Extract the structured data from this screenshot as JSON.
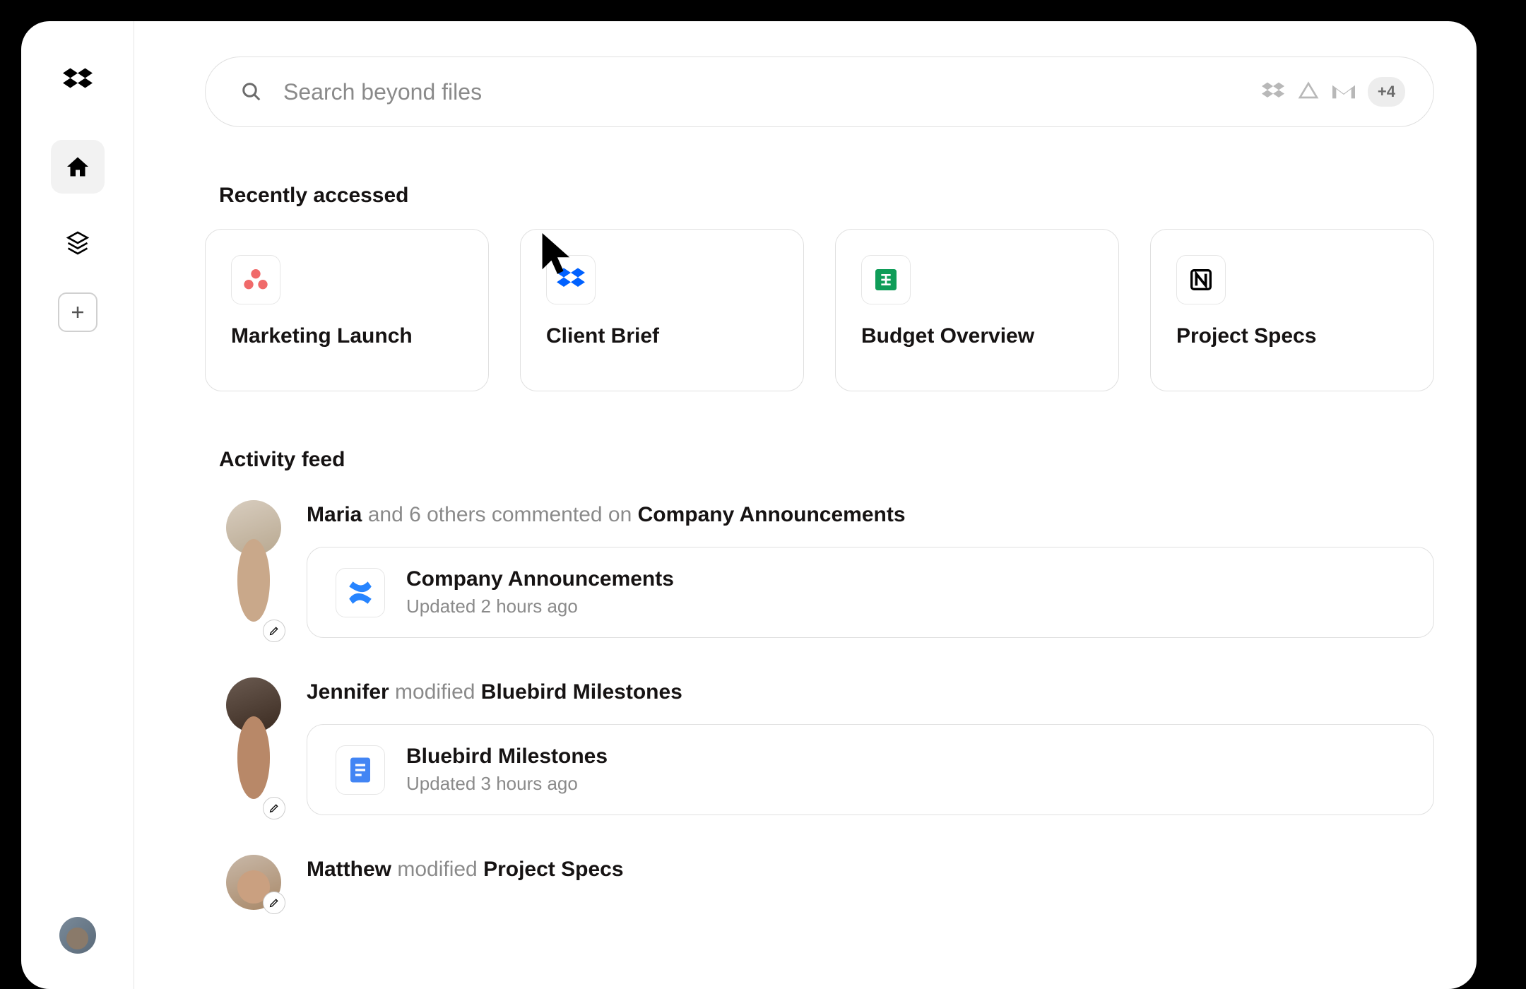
{
  "search": {
    "placeholder": "Search beyond files",
    "more_connectors": "+4"
  },
  "sections": {
    "recent_title": "Recently accessed",
    "activity_title": "Activity feed"
  },
  "recent": [
    {
      "title": "Marketing Launch",
      "icon": "asana"
    },
    {
      "title": "Client Brief",
      "icon": "dropbox"
    },
    {
      "title": "Budget Overview",
      "icon": "sheets"
    },
    {
      "title": "Project Specs",
      "icon": "notion"
    }
  ],
  "activity": [
    {
      "actor": "Maria",
      "middle": " and 6 others commented on ",
      "target": "Company Announcements",
      "card": {
        "title": "Company Announcements",
        "subtitle": "Updated 2 hours ago",
        "icon": "confluence"
      }
    },
    {
      "actor": "Jennifer",
      "middle": " modified ",
      "target": "Bluebird Milestones",
      "card": {
        "title": "Bluebird Milestones",
        "subtitle": "Updated 3 hours ago",
        "icon": "gdoc"
      }
    },
    {
      "actor": "Matthew",
      "middle": " modified ",
      "target": "Project Specs",
      "card": null
    }
  ]
}
